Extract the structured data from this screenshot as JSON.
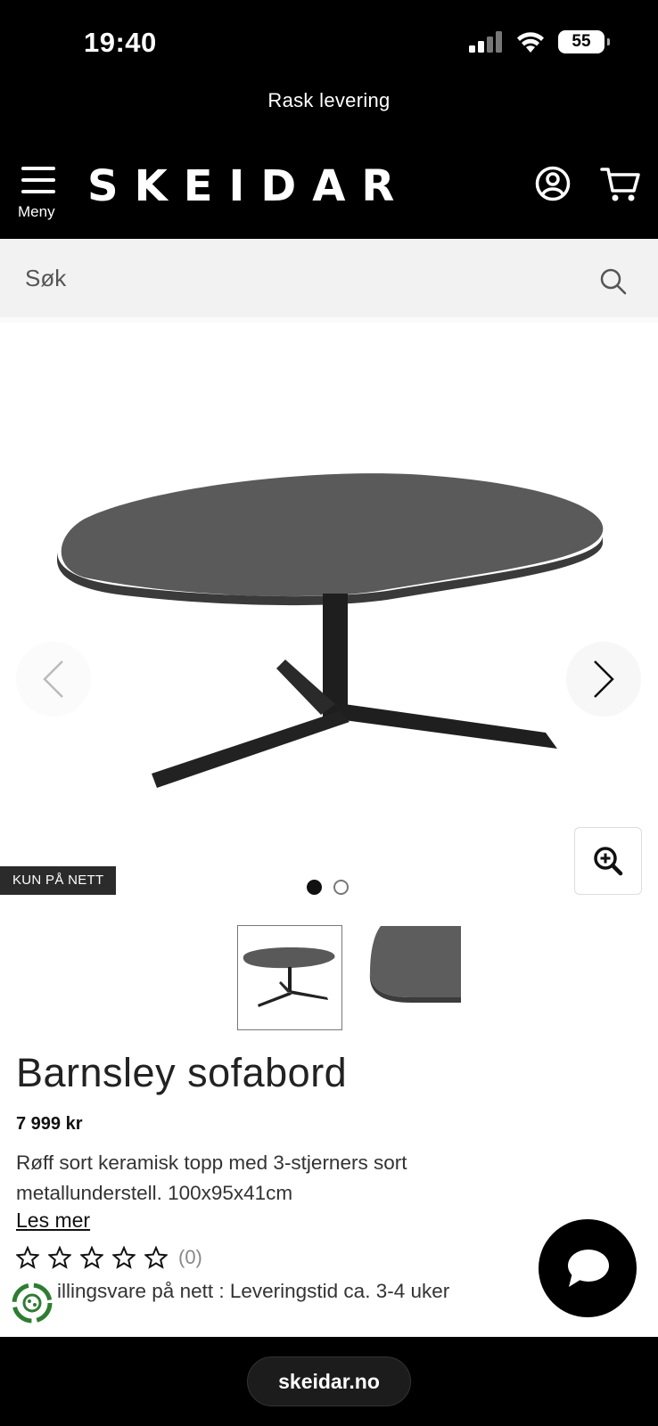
{
  "status_bar": {
    "time": "19:40",
    "battery": "55"
  },
  "promo_banner": "Rask levering",
  "header": {
    "menu_label": "Meny",
    "logo": "SKEIDAR"
  },
  "search": {
    "placeholder": "Søk"
  },
  "gallery": {
    "badge": "KUN PÅ NETT",
    "current_slide": 1,
    "total_slides": 2
  },
  "product": {
    "title": "Barnsley sofabord",
    "price": "7 999 kr",
    "description": "Røff sort keramisk topp med 3-stjerners sort metallunderstell. 100x95x41cm",
    "read_more": "Les mer",
    "rating": 0,
    "rating_max": 5,
    "review_count": "(0)",
    "delivery": "illingsvare på nett : Leveringstid ca. 3-4 uker"
  },
  "browser": {
    "url": "skeidar.no"
  }
}
